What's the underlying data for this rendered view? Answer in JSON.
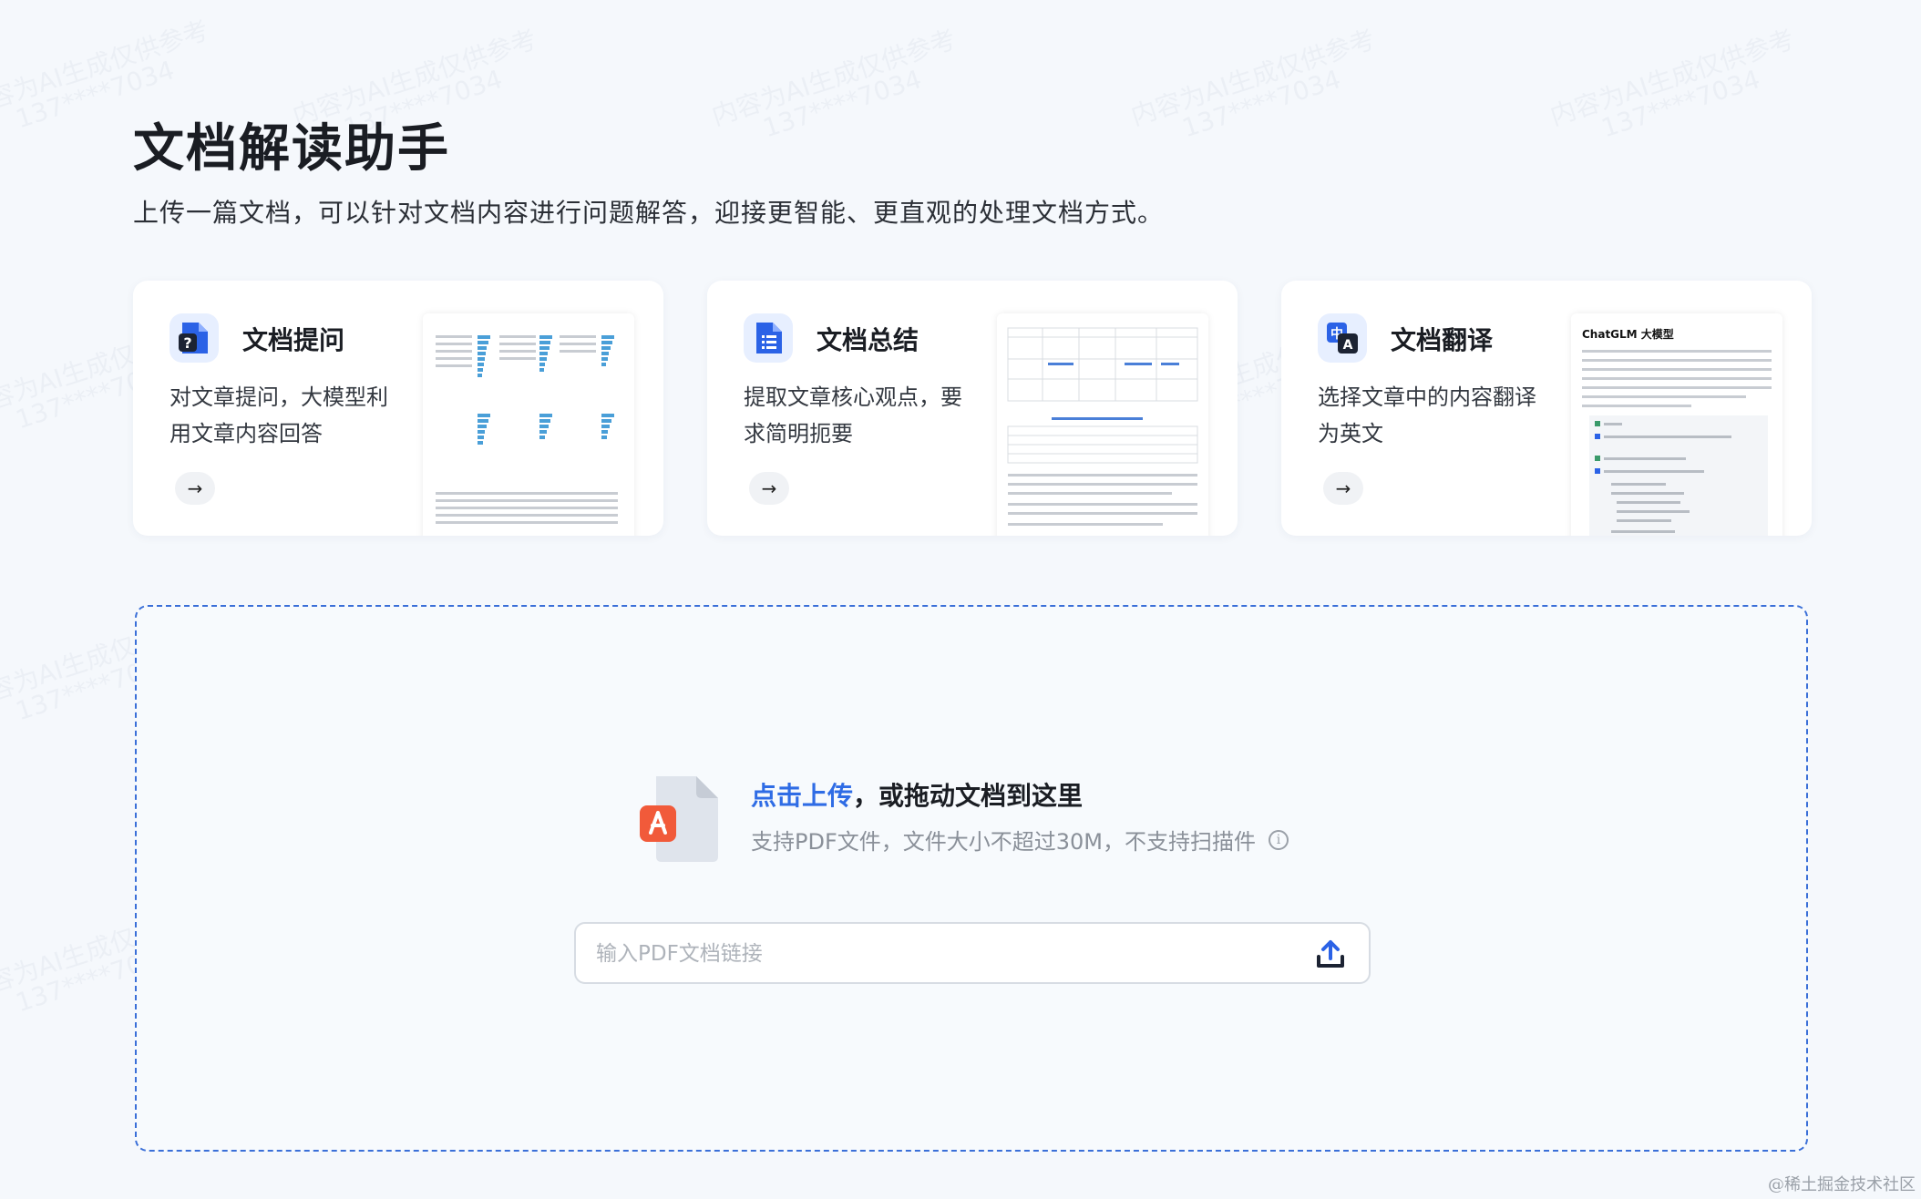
{
  "header": {
    "title": "文档解读助手",
    "subtitle": "上传一篇文档，可以针对文档内容进行问题解答，迎接更智能、更直观的处理文档方式。"
  },
  "cards": [
    {
      "title": "文档提问",
      "desc": "对文章提问，大模型利用文章内容回答",
      "icon": "document-question-icon",
      "arrow": "→"
    },
    {
      "title": "文档总结",
      "desc": "提取文章核心观点，要求简明扼要",
      "icon": "document-list-icon",
      "arrow": "→"
    },
    {
      "title": "文档翻译",
      "desc": "选择文章中的内容翻译为英文",
      "icon": "translate-icon",
      "arrow": "→",
      "preview_heading": "ChatGLM 大模型"
    }
  ],
  "upload": {
    "click_label": "点击上传",
    "drag_label": "，或拖动文档到这里",
    "hint": "支持PDF文件，文件大小不超过30M，不支持扫描件",
    "info_glyph": "i",
    "url_placeholder": "输入PDF文档链接"
  },
  "watermark": {
    "line1": "内容为AI生成仅供参考",
    "line2": "137****7034"
  },
  "footer": "@稀土掘金技术社区",
  "colors": {
    "accent": "#2f6ce5",
    "icon_blue": "#2b62e6",
    "pdf_red": "#f15a3a",
    "dashed_border": "#3a6fd8"
  }
}
